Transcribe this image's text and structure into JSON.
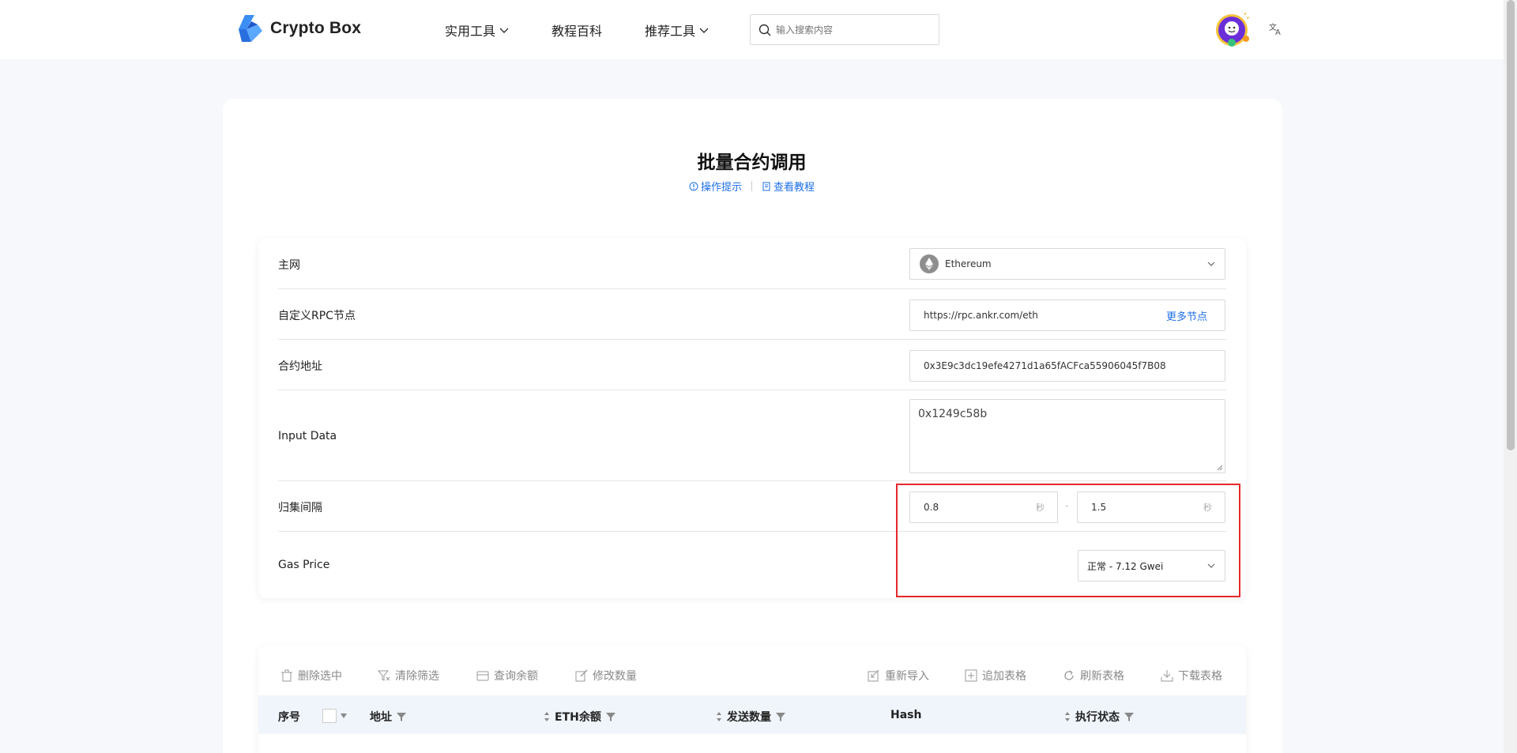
{
  "header": {
    "logo_text": "Crypto Box",
    "nav": {
      "tools": "实用工具",
      "tutorials": "教程百科",
      "recommended": "推荐工具"
    },
    "search_placeholder": "输入搜索内容"
  },
  "page": {
    "title": "批量合约调用",
    "link_tips": "操作提示",
    "link_tutorial": "查看教程"
  },
  "form": {
    "network_label": "主网",
    "network_value": "Ethereum",
    "rpc_label": "自定义RPC节点",
    "rpc_value": "https://rpc.ankr.com/eth",
    "rpc_more": "更多节点",
    "contract_label": "合约地址",
    "contract_value": "0x3E9c3dc19efe4271d1a65fACFca55906045f7B08",
    "input_label": "Input Data",
    "input_value": "0x1249c58b",
    "interval_label": "归集间隔",
    "interval_min": "0.8",
    "interval_max": "1.5",
    "interval_unit": "秒",
    "interval_sep": "-",
    "gas_label": "Gas Price",
    "gas_value": "正常 - 7.12 Gwei"
  },
  "toolbar": {
    "delete": "删除选中",
    "clear_filter": "清除筛选",
    "query_balance": "查询余额",
    "edit_amount": "修改数量",
    "reimport": "重新导入",
    "append": "追加表格",
    "refresh": "刷新表格",
    "download": "下载表格"
  },
  "table": {
    "col_index": "序号",
    "col_address": "地址",
    "col_balance": "ETH余额",
    "col_amount": "发送数量",
    "col_hash": "Hash",
    "col_status": "执行状态"
  },
  "colors": {
    "accent": "#1e6fe8",
    "highlight": "#e8262b"
  }
}
